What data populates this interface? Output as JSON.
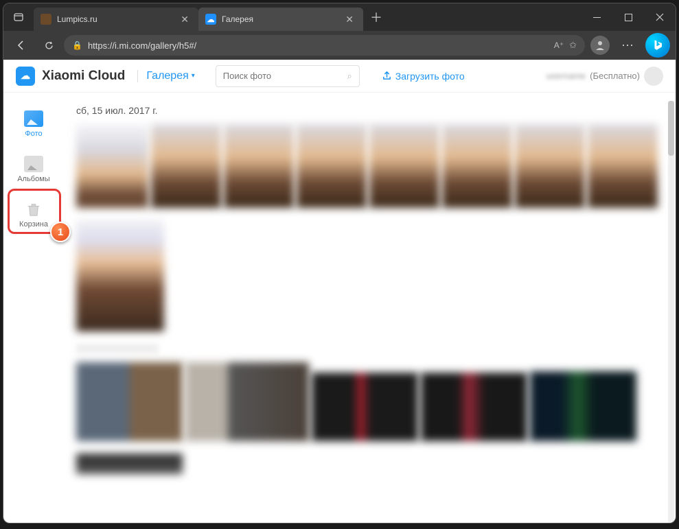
{
  "browser": {
    "tabs": [
      {
        "title": "Lumpics.ru"
      },
      {
        "title": "Галерея"
      }
    ],
    "url": "https://i.mi.com/gallery/h5#/"
  },
  "header": {
    "brand": "Xiaomi Cloud",
    "section": "Галерея",
    "search_placeholder": "Поиск фото",
    "upload_label": "Загрузить фото",
    "user_plan": "(Бесплатно)"
  },
  "sidebar": {
    "items": [
      {
        "label": "Фото"
      },
      {
        "label": "Альбомы"
      },
      {
        "label": "Корзина"
      }
    ]
  },
  "content": {
    "date_header": "сб, 15 июл. 2017 г."
  },
  "annotation": {
    "callout_number": "1"
  }
}
